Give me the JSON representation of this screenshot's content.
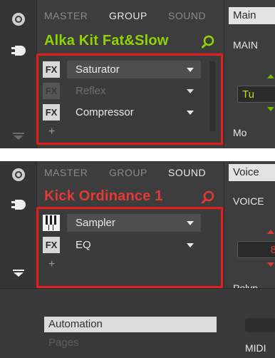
{
  "top": {
    "tabs": [
      {
        "label": "MASTER",
        "active": false
      },
      {
        "label": "GROUP",
        "active": true
      },
      {
        "label": "SOUND",
        "active": false
      }
    ],
    "title": "Alka Kit Fat&Slow",
    "title_color": "#8fd400",
    "slots": [
      {
        "badge": "FX",
        "label": "Saturator",
        "state": "selected"
      },
      {
        "badge": "FX",
        "label": "Reflex",
        "state": "bypassed"
      },
      {
        "badge": "FX",
        "label": "Compressor",
        "state": "normal"
      }
    ],
    "add_label": "+",
    "right": {
      "tab": "Main",
      "label": "MAIN",
      "value": "Tu",
      "bottom": "Mo",
      "accent": "#6fb800"
    }
  },
  "bottom": {
    "tabs": [
      {
        "label": "MASTER",
        "active": false
      },
      {
        "label": "GROUP",
        "active": false
      },
      {
        "label": "SOUND",
        "active": true
      }
    ],
    "title": "Kick Ordinance 1",
    "title_color": "#e43a35",
    "slots": [
      {
        "badge": "piano-icon",
        "label": "Sampler",
        "state": "selected"
      },
      {
        "badge": "FX",
        "label": "EQ",
        "state": "normal"
      }
    ],
    "add_label": "+",
    "right": {
      "tab": "Voice",
      "label": "VOICE",
      "value": "8",
      "bottom": "Polyp",
      "accent": "#e43a35"
    },
    "lower_tabs": [
      {
        "label": "Automation",
        "active": true
      },
      {
        "label": "Pages",
        "active": false
      }
    ],
    "midi_label": "MIDI"
  },
  "colors": {
    "highlight": "#e11d1d",
    "panel": "#3d3d3d"
  }
}
